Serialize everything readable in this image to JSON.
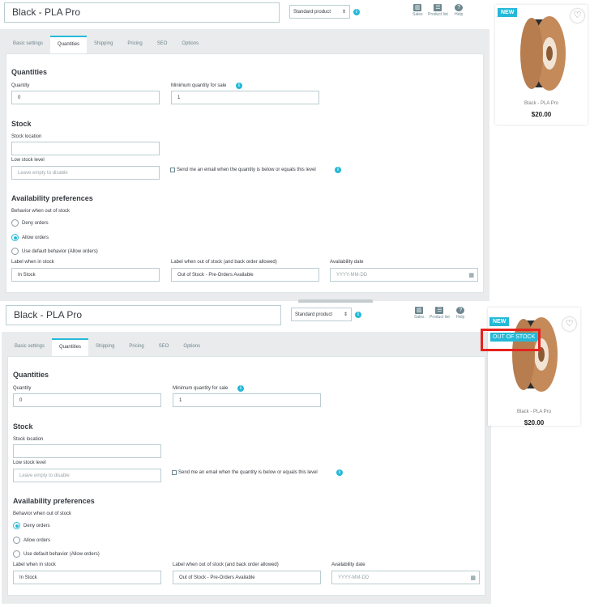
{
  "header": {
    "title": "Black - PLA Pro",
    "product_type": "Standard product",
    "buttons": [
      {
        "label": "Sales",
        "icon": "chart-icon"
      },
      {
        "label": "Product list",
        "icon": "list-icon"
      },
      {
        "label": "Help",
        "icon": "help-icon"
      }
    ]
  },
  "tabs": [
    "Basic settings",
    "Quantities",
    "Shipping",
    "Pricing",
    "SEO",
    "Options"
  ],
  "quantities": {
    "heading": "Quantities",
    "quantity_label": "Quantity",
    "quantity_value": "0",
    "min_label": "Minimum quantity for sale",
    "min_value": "1"
  },
  "stock": {
    "heading": "Stock",
    "location_label": "Stock location",
    "location_value": "",
    "low_label": "Low stock level",
    "low_placeholder": "Leave empty to disable",
    "email_label": "Send me an email when the quantity is below or equals this level"
  },
  "availability": {
    "heading": "Availability preferences",
    "behavior_label": "Behavior when out of stock",
    "options": [
      "Deny orders",
      "Allow orders",
      "Use default behavior (Allow orders)"
    ],
    "in_stock_label": "Label when in stock",
    "in_stock_value": "In Stock",
    "oos_label": "Label when out of stock (and back order allowed)",
    "oos_value": "Out of Stock - Pre-Orders Available",
    "date_label": "Availability date",
    "date_placeholder": "YYYY-MM-DD"
  },
  "product_card": {
    "badge_new": "NEW",
    "badge_oos": "OUT OF STOCK",
    "name": "Black - PLA Pro",
    "price": "$20.00"
  },
  "states": {
    "first_selected_option": "Allow orders",
    "second_selected_option": "Deny orders"
  },
  "colors": {
    "accent": "#25b9d7",
    "highlight": "#e5231d",
    "spool": "#c48a5a"
  }
}
